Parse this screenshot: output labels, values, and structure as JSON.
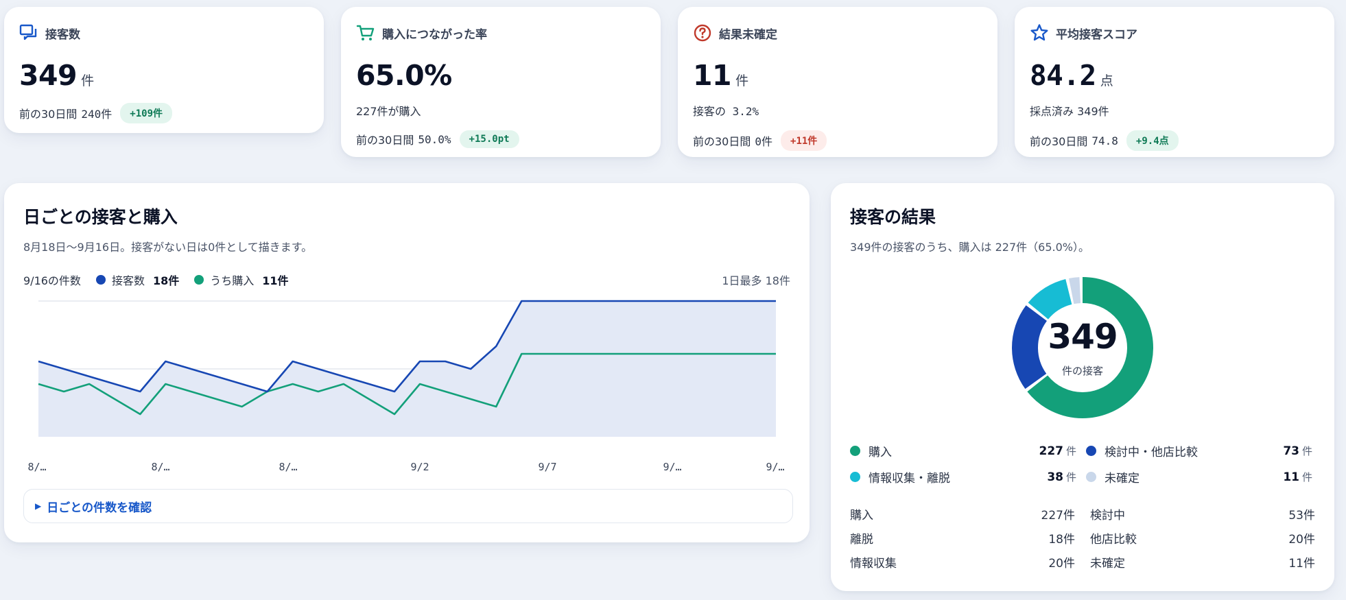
{
  "kpis": [
    {
      "icon": "chat-bubbles-icon",
      "label": "接客数",
      "value": "349",
      "unit": "件",
      "sub": "",
      "compare_label": "前の30日間",
      "compare_value": "240件",
      "delta": "+109件",
      "delta_type": "up"
    },
    {
      "icon": "cart-icon",
      "label": "購入につながった率",
      "value": "65.0%",
      "unit": "",
      "sub": "227件が購入",
      "compare_label": "前の30日間",
      "compare_value": "50.0%",
      "delta": "+15.0pt",
      "delta_type": "up"
    },
    {
      "icon": "question-circle-icon",
      "label": "結果未確定",
      "value": "11",
      "unit": "件",
      "sub": "接客の 3.2%",
      "compare_label": "前の30日間",
      "compare_value": "0件",
      "delta": "+11件",
      "delta_type": "warn"
    },
    {
      "icon": "star-icon",
      "label": "平均接客スコア",
      "value": "84.2",
      "unit": "点",
      "sub": "採点済み 349件",
      "compare_label": "前の30日間",
      "compare_value": "74.8",
      "delta": "+9.4点",
      "delta_type": "up"
    }
  ],
  "daily": {
    "title": "日ごとの接客と購入",
    "description": "8月18日〜9月16日。接客がない日は0件として描きます。",
    "legend_date": "9/16の件数",
    "legend": [
      {
        "name": "接客数",
        "value": "18件",
        "color": "#1747b3"
      },
      {
        "name": "うち購入",
        "value": "11件",
        "color": "#13a07a"
      }
    ],
    "max_label": "1日最多 18件",
    "details_label": "日ごとの件数を確認"
  },
  "chart_data": {
    "type": "area",
    "x_labels": [
      "8/…",
      "8/…",
      "8/…",
      "9/2",
      "9/7",
      "9/…",
      "9/…"
    ],
    "ylim": [
      0,
      18
    ],
    "series": [
      {
        "name": "接客数",
        "color": "#1747b3",
        "values": [
          10,
          9,
          8,
          7,
          6,
          10,
          9,
          8,
          7,
          6,
          10,
          9,
          8,
          7,
          6,
          10,
          10,
          9,
          12,
          18,
          18,
          18,
          18,
          18,
          18,
          18,
          18,
          18,
          18,
          18
        ]
      },
      {
        "name": "うち購入",
        "color": "#13a07a",
        "values": [
          7,
          6,
          7,
          5,
          3,
          7,
          6,
          5,
          4,
          6,
          7,
          6,
          7,
          5,
          3,
          7,
          6,
          5,
          4,
          11,
          11,
          11,
          11,
          11,
          11,
          11,
          11,
          11,
          11,
          11
        ]
      }
    ]
  },
  "outcome": {
    "title": "接客の結果",
    "description": "349件の接客のうち、購入は 227件（65.0%）。",
    "total": "349",
    "total_label": "件の接客",
    "legend": [
      {
        "name": "購入",
        "value": "227",
        "unit": "件",
        "color": "#13a07a"
      },
      {
        "name": "検討中・他店比較",
        "value": "73",
        "unit": "件",
        "color": "#1747b3"
      },
      {
        "name": "情報収集・離脱",
        "value": "38",
        "unit": "件",
        "color": "#17bcd4"
      },
      {
        "name": "未確定",
        "value": "11",
        "unit": "件",
        "color": "#c9d7ea"
      }
    ],
    "breakdown": [
      {
        "name": "購入",
        "value": "227件"
      },
      {
        "name": "検討中",
        "value": "53件"
      },
      {
        "name": "離脱",
        "value": "18件"
      },
      {
        "name": "他店比較",
        "value": "20件"
      },
      {
        "name": "情報収集",
        "value": "20件"
      },
      {
        "name": "未確定",
        "value": "11件"
      }
    ]
  },
  "donut_data": {
    "type": "pie",
    "values": [
      227,
      73,
      38,
      11
    ],
    "colors": [
      "#13a07a",
      "#1747b3",
      "#17bcd4",
      "#c9d7ea"
    ]
  }
}
